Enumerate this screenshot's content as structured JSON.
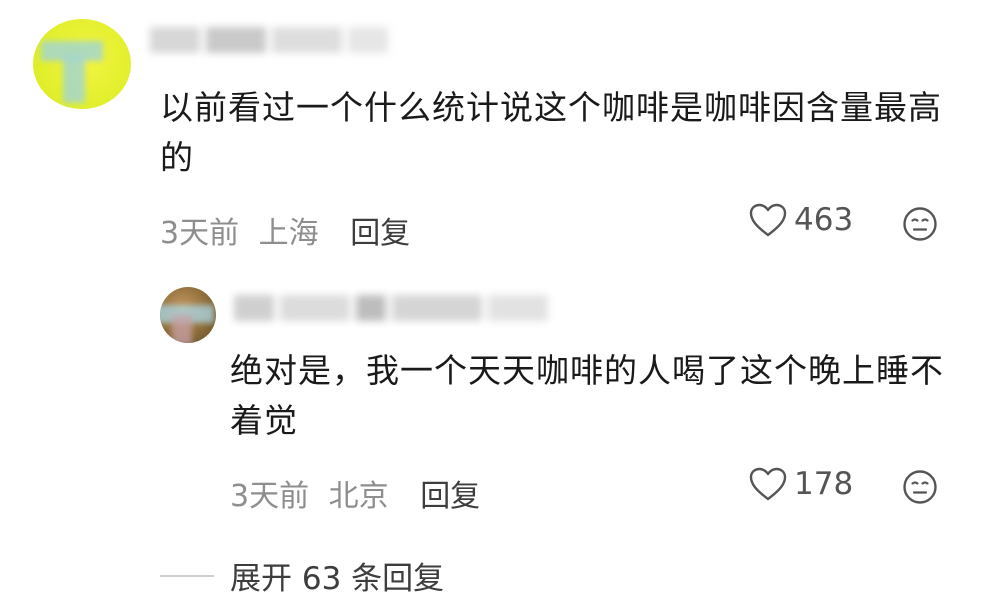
{
  "comments": [
    {
      "text": "以前看过一个什么统计说这个咖啡是咖啡因含量最高的",
      "time": "3天前",
      "location": "上海",
      "reply_label": "回复",
      "likes": "463",
      "like_icon": "heart-outline-icon",
      "emoji_icon": "neutral-face-icon"
    },
    {
      "text": "绝对是，我一个天天咖啡的人喝了这个晚上睡不着觉",
      "time": "3天前",
      "location": "北京",
      "reply_label": "回复",
      "likes": "178",
      "like_icon": "heart-outline-icon",
      "emoji_icon": "neutral-face-icon"
    }
  ],
  "expand": {
    "label": "展开 63 条回复"
  },
  "colors": {
    "text_primary": "#1a1a1a",
    "text_secondary": "#8e8e8e",
    "icon": "#555555"
  }
}
